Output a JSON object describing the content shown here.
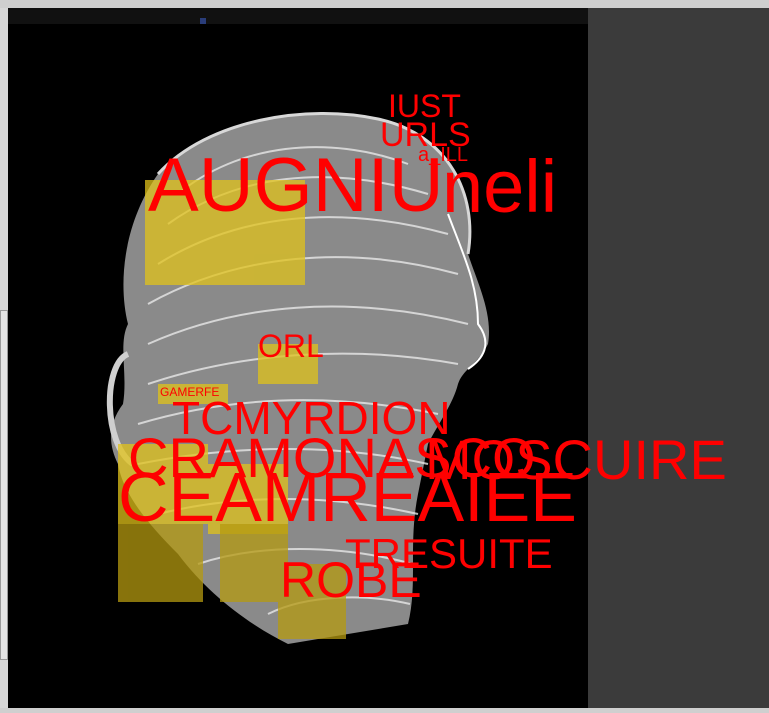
{
  "overlay_labels": {
    "iust": "IUST",
    "urls": "URLS",
    "a_ill": "a_ILL",
    "augniu": "AUGNIU",
    "neli": "neli",
    "orl": "ORL",
    "gamerfe": "GAMERFE",
    "tcmyrdion": "TCMYRDION",
    "cramonasco": "CRAMONASCO",
    "moscuire": "MOSCUIRE",
    "ceamreaiee": "CEAMREAIEE",
    "tresuite": "TRESUITE",
    "robe": "ROBE"
  },
  "colors": {
    "label": "#ff0000",
    "highlight": "#e0c21a",
    "canvas": "#000000",
    "workspace": "#3b3b3b"
  },
  "image": {
    "description_icon": "word-portrait-head-image"
  }
}
